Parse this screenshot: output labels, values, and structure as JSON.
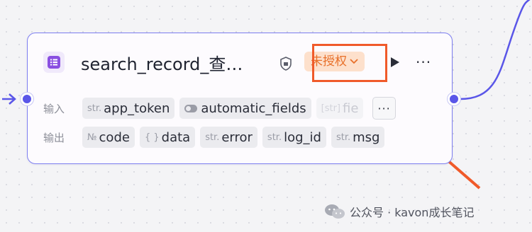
{
  "colors": {
    "accent": "#5a56e8",
    "node_border": "#7d7ef0",
    "node_icon": "#8a4fe1",
    "badge_bg": "#fde0cc",
    "badge_text": "#e8702a",
    "highlight": "#f05a2a"
  },
  "node": {
    "icon": "table-icon",
    "title": "search_record_查…",
    "auth_badge": "未授权",
    "inputs_label": "输入",
    "outputs_label": "输出",
    "inputs": [
      {
        "type": "str.",
        "name": "app_token"
      },
      {
        "type": "toggle",
        "name": "automatic_fields"
      },
      {
        "type": "[str]",
        "name": "fie"
      }
    ],
    "inputs_more": "···",
    "outputs": [
      {
        "type": "№",
        "name": "code"
      },
      {
        "type": "{ }",
        "name": "data"
      },
      {
        "type": "str.",
        "name": "error"
      },
      {
        "type": "str.",
        "name": "log_id"
      },
      {
        "type": "str.",
        "name": "msg"
      }
    ]
  },
  "watermark": {
    "text": "公众号 · kavon成长笔记"
  }
}
